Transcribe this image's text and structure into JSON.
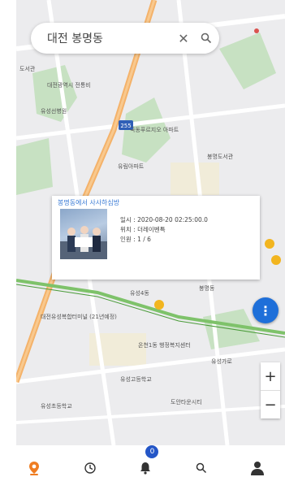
{
  "search": {
    "query": "대전 봉명동",
    "clear_icon": "close-icon",
    "search_icon": "search-icon"
  },
  "map": {
    "labels": {
      "l1": "도서관",
      "l2": "대전광역시 전통비",
      "l3": "유성선병원",
      "l4": "국동푸르지오 아파트",
      "l5": "유림아파트",
      "l6": "봉명도서관",
      "l7": "유성4동",
      "l8": "대전유성복합터미널 (21년예정)",
      "l9": "온천1동 행정복지센터",
      "l10": "유성고등학교",
      "l11": "도안타운시티",
      "l12": "유성초등학교",
      "l13": "봉명동",
      "l14": "유성가로"
    },
    "route_badge": "255"
  },
  "popup": {
    "title": "봉명동에서 사사하심방",
    "date": "일시 : 2020-08-20 02:25:00.0",
    "place": "위치 : 더레이벤특",
    "count": "인원 : 1 / 6"
  },
  "zoom": {
    "plus": "+",
    "minus": "−"
  },
  "tabbar": {
    "notification_count": "0"
  }
}
